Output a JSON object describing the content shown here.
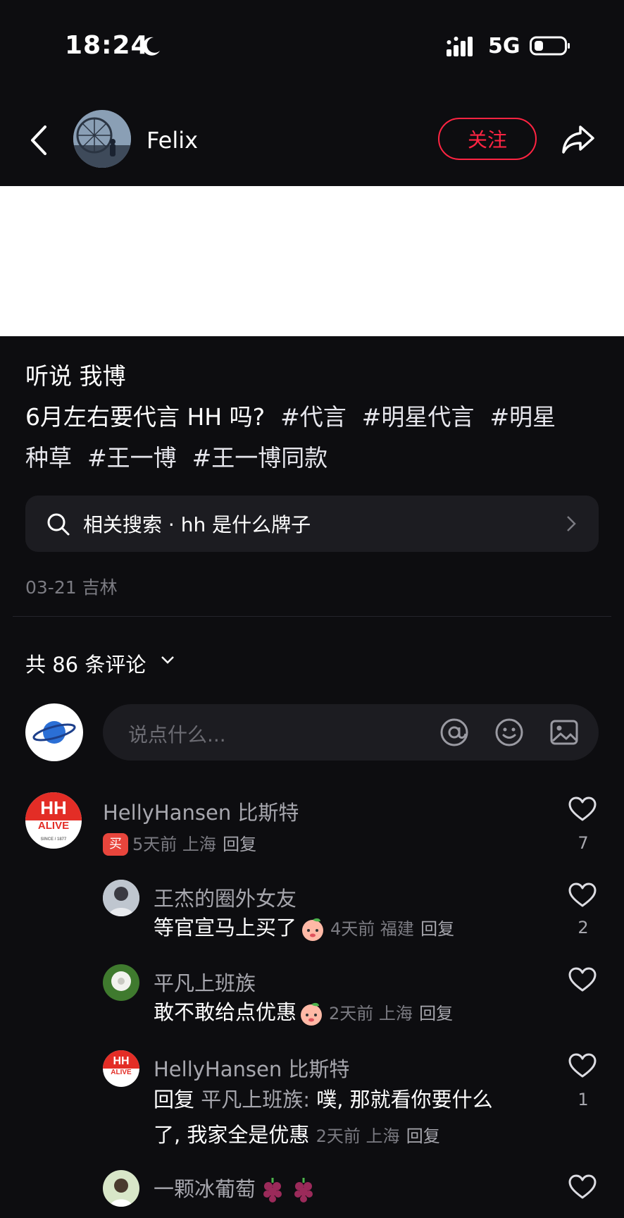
{
  "status_bar": {
    "time": "18:24",
    "network": "5G"
  },
  "header": {
    "author": "Felix",
    "follow_label": "关注"
  },
  "post": {
    "line1": "听说 我博",
    "line2_text": "6月左右要代言 HH 吗?",
    "tags": [
      "#代言",
      "#明星代言",
      "#明星",
      "种草",
      "#王一博",
      "#王一博同款"
    ],
    "related_search": "相关搜索 · hh 是什么牌子",
    "meta": "03-21 吉林"
  },
  "comments_header": {
    "count_label": "共 86 条评论"
  },
  "comment_input": {
    "placeholder": "说点什么..."
  },
  "comments": [
    {
      "name": "HellyHansen 比斯特",
      "meta": "5天前 上海",
      "reply": "回复",
      "likes": "7",
      "badge": "买"
    },
    {
      "name": "王杰的圈外女友",
      "text": "等官宣马上买了",
      "meta": "4天前 福建",
      "reply": "回复",
      "likes": "2"
    },
    {
      "name": "平凡上班族",
      "text": "敢不敢给点优惠",
      "meta": "2天前 上海",
      "reply": "回复",
      "likes": ""
    },
    {
      "name": "HellyHansen 比斯特",
      "reply_prefix": "回复",
      "reply_to": "平凡上班族:",
      "text_line1": "噗, 那就看你要什么",
      "text_line2": "了, 我家全是优惠",
      "meta": "2天前 上海",
      "reply": "回复",
      "likes": "1"
    },
    {
      "name": "一颗冰葡萄",
      "likes": ""
    }
  ],
  "logo": {
    "top": "HH",
    "bottom": "ALIVE",
    "since": "SINCE / 1877"
  },
  "colors": {
    "accent": "#ff2442",
    "background": "#0d0d10",
    "input_bg": "#1c1c21",
    "muted": "#7b7b82"
  },
  "icons": [
    "moon-icon",
    "signal-icon",
    "battery-icon",
    "back-icon",
    "share-icon",
    "search-icon",
    "chevron-right-icon",
    "chevron-down-icon",
    "at-icon",
    "emoji-icon",
    "image-icon",
    "heart-icon"
  ]
}
